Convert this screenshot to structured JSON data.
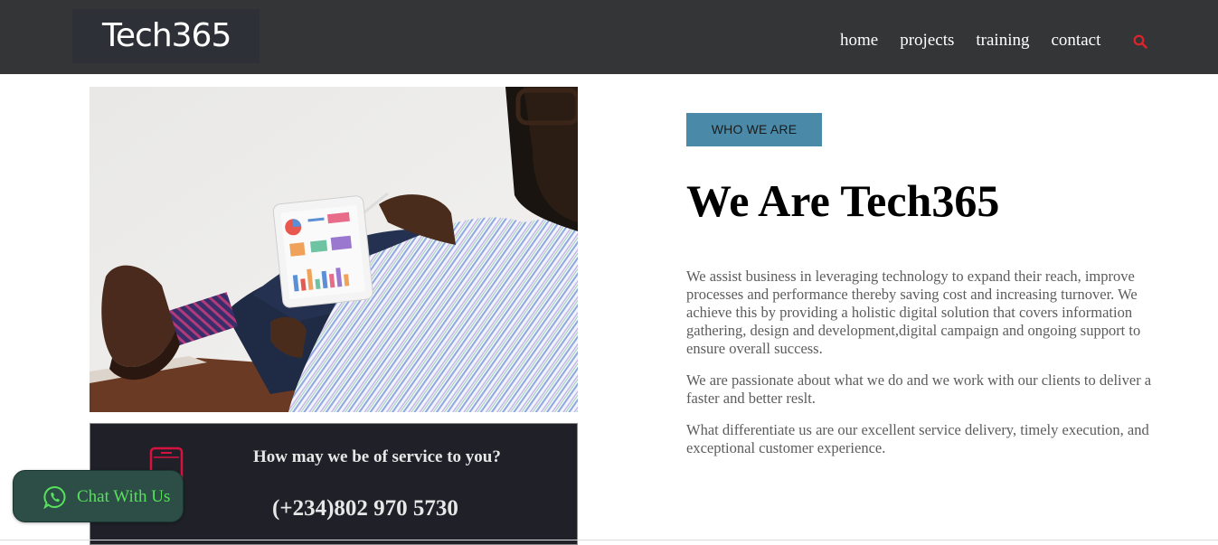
{
  "header": {
    "logo": "Tech365",
    "nav": [
      "home",
      "projects",
      "training",
      "contact"
    ],
    "search_icon": "search-icon",
    "accent": "#e0242b"
  },
  "service": {
    "question": "How may we be of service to you?",
    "phone": "(+234)802 970 5730",
    "icon": "mobile-phone-icon"
  },
  "chat": {
    "label": "Chat With Us",
    "icon": "whatsapp-icon",
    "color": "#57e05b"
  },
  "about": {
    "badge": "WHO WE ARE",
    "title": "We Are Tech365",
    "paragraphs": [
      "We assist business in leveraging technology to expand their reach, improve processes and performance thereby saving cost and increasing turnover. We achieve this by providing a holistic digital solution that covers information gathering, design and development,digital campaign and ongoing support to ensure overall success.",
      "We are passionate about what we do and we work with our clients to deliver a faster and better reslt.",
      "What differentiate us are our excellent service delivery, timely execution, and exceptional customer experience."
    ]
  },
  "colors": {
    "header_bg": "#333536",
    "badge_bg": "#4a8aa8",
    "service_bg": "#1f2028",
    "phone_icon": "#d8123f"
  }
}
